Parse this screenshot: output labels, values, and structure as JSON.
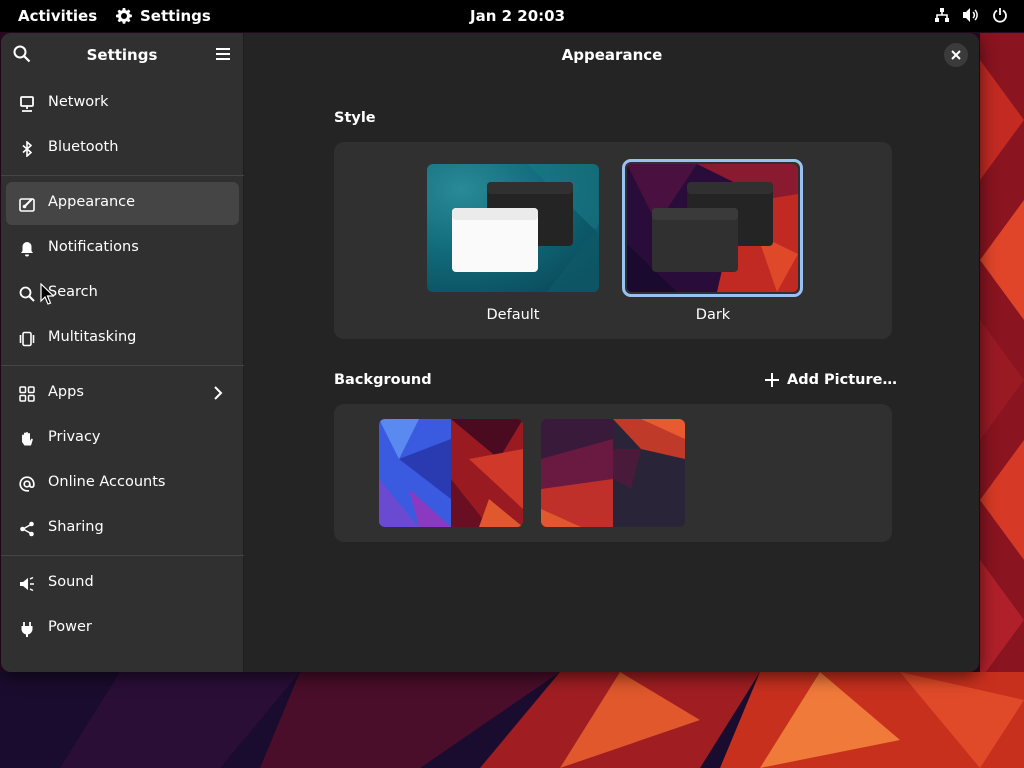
{
  "topbar": {
    "activities": "Activities",
    "app_name": "Settings",
    "clock": "Jan 2  20:03",
    "status_icons": [
      "network-icon",
      "volume-icon",
      "power-icon"
    ]
  },
  "sidebar": {
    "title": "Settings",
    "groups": [
      [
        {
          "label": "Network",
          "icon": "network-icon"
        },
        {
          "label": "Bluetooth",
          "icon": "bluetooth-icon"
        }
      ],
      [
        {
          "label": "Appearance",
          "icon": "appearance-icon",
          "active": true
        },
        {
          "label": "Notifications",
          "icon": "bell-icon"
        },
        {
          "label": "Search",
          "icon": "search-icon"
        },
        {
          "label": "Multitasking",
          "icon": "multitasking-icon"
        }
      ],
      [
        {
          "label": "Apps",
          "icon": "apps-icon",
          "has_chevron": true
        },
        {
          "label": "Privacy",
          "icon": "hand-icon"
        },
        {
          "label": "Online Accounts",
          "icon": "at-icon"
        },
        {
          "label": "Sharing",
          "icon": "share-icon"
        }
      ],
      [
        {
          "label": "Sound",
          "icon": "speaker-icon"
        },
        {
          "label": "Power",
          "icon": "plug-icon"
        }
      ]
    ]
  },
  "content": {
    "title": "Appearance",
    "style": {
      "heading": "Style",
      "options": [
        {
          "label": "Default",
          "selected": false
        },
        {
          "label": "Dark",
          "selected": true
        }
      ]
    },
    "background": {
      "heading": "Background",
      "add_button": "Add Picture…"
    }
  },
  "colors": {
    "accent": "#99c1f1",
    "window_bg": "#242424",
    "sidebar_bg": "#303030",
    "active_item": "#454545"
  }
}
